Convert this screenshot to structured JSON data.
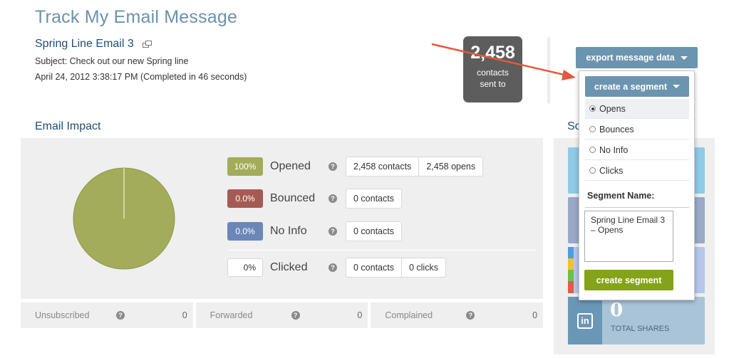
{
  "header": {
    "title": "Track My Email Message",
    "email_name": "Spring Line Email 3",
    "subject": "Subject: Check out our new Spring line",
    "sent_info": "April 24, 2012 3:38:17 PM (Completed in 46 seconds)"
  },
  "sent_summary": {
    "count": "2,458",
    "label_line1": "contacts",
    "label_line2": "sent to"
  },
  "export_button": {
    "label": "export message data"
  },
  "email_impact": {
    "title": "Email Impact",
    "pie": {
      "opened_fraction": 1.0,
      "color": "#a3ac5a",
      "border": "#8f9746"
    },
    "metrics": [
      {
        "key": "opened",
        "percent": "100%",
        "label": "Opened",
        "stats": [
          "2,458 contacts",
          "2,458 opens"
        ],
        "color": "#a3ac5a"
      },
      {
        "key": "bounced",
        "percent": "0.0%",
        "label": "Bounced",
        "stats": [
          "0 contacts"
        ],
        "color": "#a55a53"
      },
      {
        "key": "noinfo",
        "percent": "0.0%",
        "label": "No Info",
        "stats": [
          "0 contacts"
        ],
        "color": "#6b87b8"
      },
      {
        "key": "clicked",
        "percent": "0%",
        "label": "Clicked",
        "stats": [
          "0 contacts",
          "0 clicks"
        ],
        "color": "#ffffff"
      }
    ]
  },
  "footer_stats": [
    {
      "label": "Unsubscribed",
      "value": "0"
    },
    {
      "label": "Forwarded",
      "value": "0"
    },
    {
      "label": "Complained",
      "value": "0"
    }
  ],
  "social": {
    "title_partial": "So",
    "linkedin": {
      "shares": "0",
      "label": "TOTAL SHARES",
      "logo_text": "in"
    }
  },
  "segment_dropdown": {
    "button_label": "create a segment",
    "options": [
      "Opens",
      "Bounces",
      "No Info",
      "Clicks"
    ],
    "selected": "Opens",
    "name_label": "Segment Name:",
    "name_value": "Spring Line Email 3 – Opens",
    "create_label": "create segment"
  },
  "colors": {
    "accent_blue": "#6b94b0",
    "title_blue": "#6b92ad",
    "green_button": "#84a31a",
    "arrow_red": "#e4583c"
  }
}
